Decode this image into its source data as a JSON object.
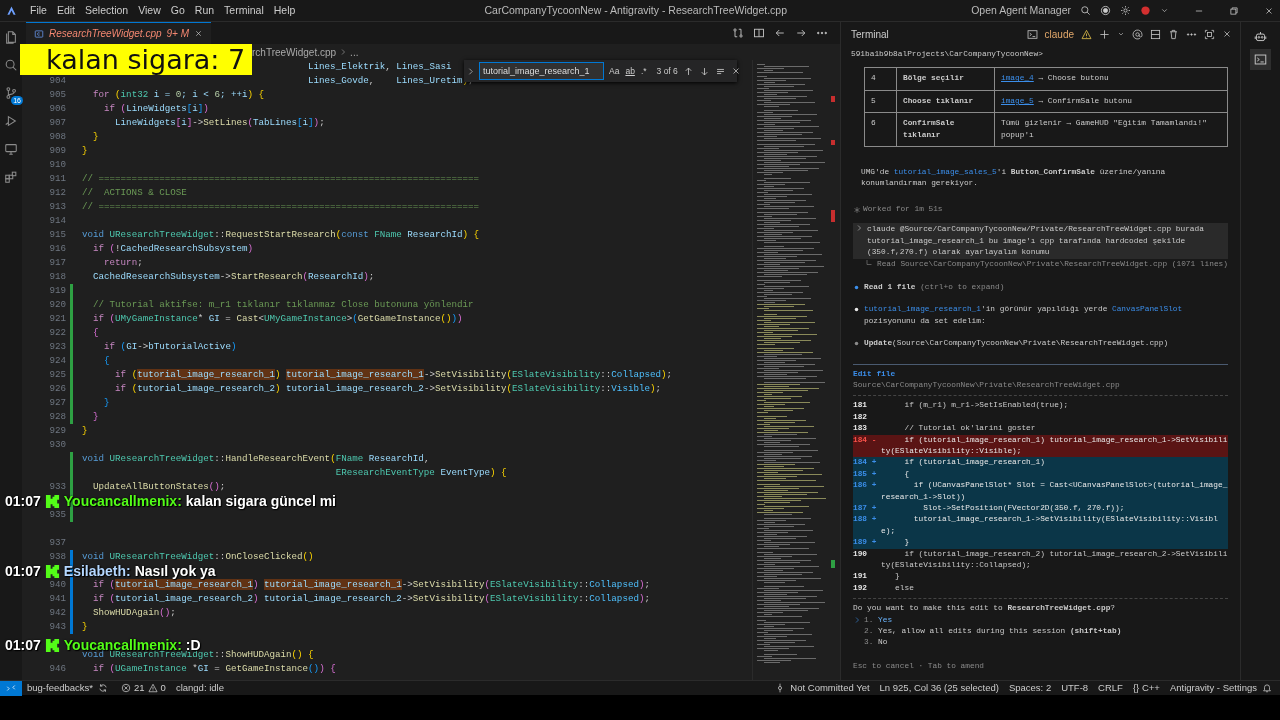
{
  "titlebar": {
    "menu": [
      "File",
      "Edit",
      "Selection",
      "View",
      "Go",
      "Run",
      "Terminal",
      "Help"
    ],
    "title": "CarCompanyTycoonNew - Antigravity - ResearchTreeWidget.cpp",
    "agent_manager": "Open Agent Manager"
  },
  "activity_badge": "16",
  "overlay_counter": "kalan sigara: 7",
  "chat": [
    {
      "time": "01:07",
      "user": "Youcancallmenix:",
      "color": "#53fc18",
      "text": "kalan sigara güncel mi"
    },
    {
      "time": "01:07",
      "user": "Esilabeth:",
      "color": "#b4d7ff",
      "text": "Nasıl yok ya"
    },
    {
      "time": "01:07",
      "user": "Youcancallmenix:",
      "color": "#53fc18",
      "text": ":D"
    }
  ],
  "editor": {
    "tab": {
      "label": "ResearchTreeWidget.cpp",
      "badge": "9+ M"
    },
    "breadcrumb": [
      "rchTreeWidget.cpp",
      "..."
    ],
    "find": {
      "value": "tutorial_image_research_1",
      "toggles": [
        "Aa",
        "ab",
        ".*"
      ],
      "result": "3 of 6"
    },
    "lines": [
      {
        "segments": [
          {
            "text": "                                         Lines_Elektrik",
            "kind": "variable"
          },
          {
            "text": ", ",
            "kind": "plain"
          },
          {
            "text": "Lines_Sasi",
            "kind": "variable"
          }
        ]
      },
      {
        "number": "904",
        "segments": [
          {
            "text": "                                         Lines_Govde",
            "kind": "variable"
          },
          {
            "text": ",    ",
            "kind": "plain"
          },
          {
            "text": "Lines_Uretim",
            "kind": "variable"
          },
          {
            "text": ")",
            "kind": "bracket1"
          },
          {
            "text": ";",
            "kind": "plain"
          }
        ]
      },
      {
        "number": "905",
        "segments": [
          {
            "text": "  for ",
            "kind": "control"
          },
          {
            "text": "(",
            "kind": "bracket1"
          },
          {
            "text": "int32",
            "kind": "type"
          },
          {
            "text": " i = ",
            "kind": "variable"
          },
          {
            "text": "0",
            "kind": "number"
          },
          {
            "text": "; i < ",
            "kind": "variable"
          },
          {
            "text": "6",
            "kind": "number"
          },
          {
            "text": "; ++i",
            "kind": "variable"
          },
          {
            "text": ")",
            "kind": "bracket1"
          },
          {
            "text": " {",
            "kind": "bracket1"
          }
        ]
      },
      {
        "number": "906",
        "segments": [
          {
            "text": "    if ",
            "kind": "control"
          },
          {
            "text": "(",
            "kind": "bracket2"
          },
          {
            "text": "LineWidgets",
            "kind": "variable"
          },
          {
            "text": "[",
            "kind": "bracket3"
          },
          {
            "text": "i",
            "kind": "variable"
          },
          {
            "text": "]",
            "kind": "bracket3"
          },
          {
            "text": ")",
            "kind": "bracket2"
          }
        ]
      },
      {
        "number": "907",
        "segments": [
          {
            "text": "      LineWidgets",
            "kind": "variable"
          },
          {
            "text": "[",
            "kind": "bracket2"
          },
          {
            "text": "i",
            "kind": "variable"
          },
          {
            "text": "]",
            "kind": "bracket2"
          },
          {
            "text": "->",
            "kind": "plain"
          },
          {
            "text": "SetLines",
            "kind": "function"
          },
          {
            "text": "(",
            "kind": "bracket2"
          },
          {
            "text": "TabLines",
            "kind": "variable"
          },
          {
            "text": "[",
            "kind": "bracket3"
          },
          {
            "text": "i",
            "kind": "variable"
          },
          {
            "text": "]",
            "kind": "bracket3"
          },
          {
            "text": ")",
            "kind": "bracket2"
          },
          {
            "text": ";",
            "kind": "plain"
          }
        ]
      },
      {
        "number": "908",
        "segments": [
          {
            "text": "  }",
            "kind": "bracket1"
          }
        ]
      },
      {
        "number": "909",
        "segments": [
          {
            "text": "}",
            "kind": "bracket1"
          }
        ]
      },
      {
        "number": "910"
      },
      {
        "number": "911",
        "segments": [
          {
            "text": "// =====================================================================",
            "kind": "comment"
          }
        ]
      },
      {
        "number": "912",
        "segments": [
          {
            "text": "//  ACTIONS & CLOSE",
            "kind": "comment"
          }
        ]
      },
      {
        "number": "913",
        "segments": [
          {
            "text": "// =====================================================================",
            "kind": "comment"
          }
        ]
      },
      {
        "number": "914"
      },
      {
        "number": "915",
        "segments": [
          {
            "text": "void ",
            "kind": "keyword"
          },
          {
            "text": "UResearchTreeWidget",
            "kind": "type"
          },
          {
            "text": "::",
            "kind": "plain"
          },
          {
            "text": "RequestStartResearch",
            "kind": "function"
          },
          {
            "text": "(",
            "kind": "bracket1"
          },
          {
            "text": "const ",
            "kind": "keyword"
          },
          {
            "text": "FName",
            "kind": "type"
          },
          {
            "text": " ResearchId",
            "kind": "variable"
          },
          {
            "text": ")",
            "kind": "bracket1"
          },
          {
            "text": " {",
            "kind": "bracket1"
          }
        ]
      },
      {
        "number": "916",
        "segments": [
          {
            "text": "  if ",
            "kind": "control"
          },
          {
            "text": "(",
            "kind": "bracket2"
          },
          {
            "text": "!",
            "kind": "plain"
          },
          {
            "text": "CachedResearchSubsystem",
            "kind": "variable"
          },
          {
            "text": ")",
            "kind": "bracket2"
          }
        ]
      },
      {
        "number": "917",
        "segments": [
          {
            "text": "    return",
            "kind": "control"
          },
          {
            "text": ";",
            "kind": "plain"
          }
        ]
      },
      {
        "number": "918",
        "segments": [
          {
            "text": "  CachedResearchSubsystem",
            "kind": "variable"
          },
          {
            "text": "->",
            "kind": "plain"
          },
          {
            "text": "StartResearch",
            "kind": "function"
          },
          {
            "text": "(",
            "kind": "bracket2"
          },
          {
            "text": "ResearchId",
            "kind": "variable"
          },
          {
            "text": ")",
            "kind": "bracket2"
          },
          {
            "text": ";",
            "kind": "plain"
          }
        ]
      },
      {
        "number": "919",
        "color": "#2ea043"
      },
      {
        "number": "920",
        "color": "#2ea043",
        "segments": [
          {
            "text": "  // Tutorial aktifse: m_r1 tıklanır tıklanmaz Close butonuna yönlendir",
            "kind": "comment"
          }
        ]
      },
      {
        "number": "921",
        "color": "#2ea043",
        "segments": [
          {
            "text": "  if ",
            "kind": "control"
          },
          {
            "text": "(",
            "kind": "bracket2"
          },
          {
            "text": "UMyGameInstance",
            "kind": "type"
          },
          {
            "text": "* ",
            "kind": "plain"
          },
          {
            "text": "GI",
            "kind": "variable"
          },
          {
            "text": " = ",
            "kind": "plain"
          },
          {
            "text": "Cast",
            "kind": "function"
          },
          {
            "text": "<",
            "kind": "plain"
          },
          {
            "text": "UMyGameInstance",
            "kind": "type"
          },
          {
            "text": ">",
            "kind": "plain"
          },
          {
            "text": "(",
            "kind": "bracket3"
          },
          {
            "text": "GetGameInstance",
            "kind": "function"
          },
          {
            "text": "()",
            "kind": "bracket1"
          },
          {
            "text": ")",
            "kind": "bracket3"
          },
          {
            "text": ")",
            "kind": "bracket2"
          }
        ]
      },
      {
        "number": "922",
        "color": "#2ea043",
        "segments": [
          {
            "text": "  {",
            "kind": "bracket2"
          }
        ]
      },
      {
        "number": "923",
        "color": "#2ea043",
        "segments": [
          {
            "text": "    if ",
            "kind": "control"
          },
          {
            "text": "(",
            "kind": "bracket3"
          },
          {
            "text": "GI",
            "kind": "variable"
          },
          {
            "text": "->",
            "kind": "plain"
          },
          {
            "text": "bTutorialActive",
            "kind": "variable"
          },
          {
            "text": ")",
            "kind": "bracket3"
          }
        ]
      },
      {
        "number": "924",
        "color": "#2ea043",
        "segments": [
          {
            "text": "    {",
            "kind": "bracket3"
          }
        ]
      },
      {
        "number": "925",
        "color": "#2ea043",
        "segments": [
          {
            "text": "      if ",
            "kind": "control"
          },
          {
            "text": "(",
            "kind": "bracket1"
          },
          {
            "text": "tutorial_image_research_1",
            "kind": "variable",
            "match": true
          },
          {
            "text": ") ",
            "kind": "bracket1"
          },
          {
            "text": "tutorial_image_research_1",
            "kind": "variable",
            "match": true
          },
          {
            "text": "->",
            "kind": "plain"
          },
          {
            "text": "SetVisibility",
            "kind": "function"
          },
          {
            "text": "(",
            "kind": "bracket1"
          },
          {
            "text": "ESlateVisibility",
            "kind": "type"
          },
          {
            "text": "::",
            "kind": "plain"
          },
          {
            "text": "Collapsed",
            "kind": "enum"
          },
          {
            "text": ")",
            "kind": "bracket1"
          },
          {
            "text": ";",
            "kind": "plain"
          }
        ]
      },
      {
        "number": "926",
        "color": "#2ea043",
        "segments": [
          {
            "text": "      if ",
            "kind": "control"
          },
          {
            "text": "(",
            "kind": "bracket1"
          },
          {
            "text": "tutorial_image_research_2",
            "kind": "variable"
          },
          {
            "text": ") ",
            "kind": "bracket1"
          },
          {
            "text": "tutorial_image_research_2",
            "kind": "variable"
          },
          {
            "text": "->",
            "kind": "plain"
          },
          {
            "text": "SetVisibility",
            "kind": "function"
          },
          {
            "text": "(",
            "kind": "bracket1"
          },
          {
            "text": "ESlateVisibility",
            "kind": "type"
          },
          {
            "text": "::",
            "kind": "plain"
          },
          {
            "text": "Visible",
            "kind": "enum"
          },
          {
            "text": ")",
            "kind": "bracket1"
          },
          {
            "text": ";",
            "kind": "plain"
          }
        ]
      },
      {
        "number": "927",
        "color": "#2ea043",
        "segments": [
          {
            "text": "    }",
            "kind": "bracket3"
          }
        ]
      },
      {
        "number": "928",
        "color": "#2ea043",
        "segments": [
          {
            "text": "  }",
            "kind": "bracket2"
          }
        ]
      },
      {
        "number": "929",
        "segments": [
          {
            "text": "}",
            "kind": "bracket1"
          }
        ]
      },
      {
        "number": "930"
      },
      {
        "color": "#2ea043",
        "segments": [
          {
            "text": "void ",
            "kind": "keyword"
          },
          {
            "text": "UResearchTreeWidget",
            "kind": "type"
          },
          {
            "text": "::",
            "kind": "plain"
          },
          {
            "text": "HandleResearchEvent",
            "kind": "function"
          },
          {
            "text": "(",
            "kind": "bracket1"
          },
          {
            "text": "FName",
            "kind": "type"
          },
          {
            "text": " ResearchId",
            "kind": "variable"
          },
          {
            "text": ",",
            "kind": "plain"
          }
        ]
      },
      {
        "color": "#2ea043",
        "segments": [
          {
            "text": "                                              EResearchEventType",
            "kind": "type"
          },
          {
            "text": " EventType",
            "kind": "variable"
          },
          {
            "text": ")",
            "kind": "bracket1"
          },
          {
            "text": " {",
            "kind": "bracket1"
          }
        ]
      },
      {
        "number": "933",
        "color": "#2ea043",
        "segments": [
          {
            "text": "  UpdateAllButtonStates",
            "kind": "function"
          },
          {
            "text": "()",
            "kind": "bracket2"
          },
          {
            "text": ";",
            "kind": "plain"
          }
        ]
      },
      {
        "color": "#2ea043"
      },
      {
        "number": "935",
        "color": "#2ea043"
      },
      {
        "number": "937"
      },
      {
        "number": "938",
        "color": "#0078d4",
        "segments": [
          {
            "text": "void ",
            "kind": "keyword"
          },
          {
            "text": "UResearchTreeWidget",
            "kind": "type"
          },
          {
            "text": "::",
            "kind": "plain"
          },
          {
            "text": "OnCloseClicked",
            "kind": "function"
          },
          {
            "text": "()",
            "kind": "bracket1"
          }
        ]
      },
      {
        "color": "#0078d4"
      },
      {
        "number": "940",
        "color": "#0078d4",
        "segments": [
          {
            "text": "  if ",
            "kind": "control"
          },
          {
            "text": "(",
            "kind": "bracket2"
          },
          {
            "text": "tutorial_image_research_1",
            "kind": "variable",
            "match": true
          },
          {
            "text": ") ",
            "kind": "bracket2"
          },
          {
            "text": "tutorial_image_research_1",
            "kind": "variable",
            "match": true
          },
          {
            "text": "->",
            "kind": "plain"
          },
          {
            "text": "SetVisibility",
            "kind": "function"
          },
          {
            "text": "(",
            "kind": "bracket2"
          },
          {
            "text": "ESlateVisibility",
            "kind": "type"
          },
          {
            "text": "::",
            "kind": "plain"
          },
          {
            "text": "Collapsed",
            "kind": "enum"
          },
          {
            "text": ")",
            "kind": "bracket2"
          },
          {
            "text": ";",
            "kind": "plain"
          }
        ]
      },
      {
        "number": "941",
        "color": "#0078d4",
        "segments": [
          {
            "text": "  if ",
            "kind": "control"
          },
          {
            "text": "(",
            "kind": "bracket2"
          },
          {
            "text": "tutorial_image_research_2",
            "kind": "variable"
          },
          {
            "text": ") ",
            "kind": "bracket2"
          },
          {
            "text": "tutorial_image_research_2",
            "kind": "variable"
          },
          {
            "text": "->",
            "kind": "plain"
          },
          {
            "text": "SetVisibility",
            "kind": "function"
          },
          {
            "text": "(",
            "kind": "bracket2"
          },
          {
            "text": "ESlateVisibility",
            "kind": "type"
          },
          {
            "text": "::",
            "kind": "plain"
          },
          {
            "text": "Collapsed",
            "kind": "enum"
          },
          {
            "text": ")",
            "kind": "bracket2"
          },
          {
            "text": ";",
            "kind": "plain"
          }
        ]
      },
      {
        "number": "942",
        "color": "#0078d4",
        "segments": [
          {
            "text": "  ShowHUDAgain",
            "kind": "function"
          },
          {
            "text": "()",
            "kind": "bracket2"
          },
          {
            "text": ";",
            "kind": "plain"
          }
        ]
      },
      {
        "number": "943",
        "color": "#0078d4",
        "segments": [
          {
            "text": "}",
            "kind": "bracket1"
          }
        ]
      },
      {
        "segments": [
          {
            "text": "void ",
            "kind": "keyword"
          },
          {
            "text": "UResearchTreeWidget",
            "kind": "type"
          },
          {
            "text": "::",
            "kind": "plain"
          },
          {
            "text": "ShowHUDAgain",
            "kind": "function"
          },
          {
            "text": "()",
            "kind": "bracket1"
          },
          {
            "text": " {",
            "kind": "bracket1"
          }
        ]
      },
      {
        "number": "946",
        "segments": [
          {
            "text": "  if ",
            "kind": "control"
          },
          {
            "text": "(",
            "kind": "bracket2"
          },
          {
            "text": "UGameInstance",
            "kind": "type"
          },
          {
            "text": " *",
            "kind": "plain"
          },
          {
            "text": "GI",
            "kind": "variable"
          },
          {
            "text": " = ",
            "kind": "plain"
          },
          {
            "text": "GetGameInstance",
            "kind": "function"
          },
          {
            "text": "()",
            "kind": "bracket3"
          },
          {
            "text": ")",
            "kind": "bracket2"
          },
          {
            "text": " {",
            "kind": "bracket2"
          }
        ]
      }
    ]
  },
  "terminal": {
    "title": "Terminal",
    "session": "claude",
    "path": "591ba1b9b8alProjects\\CarCompanyTycoonNew>",
    "table": [
      {
        "step": "4",
        "action": "Bölge seçilir",
        "link": "image_4",
        "detail": " → Choose butonu"
      },
      {
        "step": "5",
        "action": "Choose tıklanır",
        "link": "image_5",
        "detail": " → ConfirmSale butonu"
      },
      {
        "step": "6",
        "action": "ConfirmSale tıklanır",
        "detail": "Tümü gizlenir → GameHUD \"Eğitim Tamamlandı!\" popup'ı"
      }
    ],
    "note": [
      {
        "text": "UMG'de ",
        "kind": "plain"
      },
      {
        "text": "tutorial_image_sales_5",
        "kind": "code"
      },
      {
        "text": "'i ",
        "kind": "plain"
      },
      {
        "text": "Button_ConfirmSale",
        "kind": "bold"
      },
      {
        "text": " üzerine/yanına konumlandırman gerekiyor.",
        "kind": "plain"
      }
    ],
    "worked": "Worked for 1m 51s",
    "prompt": "claude @Source/CarCompanyTycoonNew/Private/ResearchTreeWidget.cpp burada tutorial_image_research_1 bu image'ı cpp tarafında hardcoded şekilde (350.f,270.f)  olarak ayarlayalım konumu",
    "tool_result": "Read Source\\CarCompanyTycoonNew\\Private\\ResearchTreeWidget.cpp (1071 lines)",
    "bullets": [
      {
        "color": "#3b8eea",
        "segments": [
          {
            "text": "Read 1 file",
            "kind": "bold"
          },
          {
            "text": " (ctrl+o to expand)",
            "kind": "dim"
          }
        ]
      },
      {
        "color": "#e8e8e8",
        "segments": [
          {
            "text": "tutorial_image_research_1",
            "kind": "code"
          },
          {
            "text": "'in görünür yapıldığı yerde ",
            "kind": "plain"
          },
          {
            "text": "CanvasPanelSlot",
            "kind": "code"
          },
          {
            "text": " pozisyonunu da set edelim:",
            "kind": "plain"
          }
        ]
      },
      {
        "color": "#8a8a8a",
        "segments": [
          {
            "text": "Update",
            "kind": "bold"
          },
          {
            "text": "(Source\\CarCompanyTycoonNew\\Private\\ResearchTreeWidget.cpp)",
            "kind": "plain"
          }
        ]
      }
    ],
    "edit": {
      "title": "Edit file",
      "path": "Source\\CarCompanyTycoonNew\\Private\\ResearchTreeWidget.cpp",
      "lines": [
        {
          "number": "181",
          "kind": "context",
          "text": "     if (m_r1) m_r1->SetIsEnabled(true);"
        },
        {
          "number": "182",
          "kind": "context"
        },
        {
          "number": "183",
          "kind": "context",
          "text": "     // Tutorial ok'larini goster"
        },
        {
          "number": "184",
          "sign": "-",
          "kind": "removed",
          "text": "     if (tutorial_image_research_1) tutorial_image_research_1->SetVisibility(ESlateVisibility::Visible);"
        },
        {
          "number": "184",
          "sign": "+",
          "kind": "added",
          "text": "     if (tutorial_image_research_1)"
        },
        {
          "number": "185",
          "sign": "+",
          "kind": "added",
          "text": "     {"
        },
        {
          "number": "186",
          "sign": "+",
          "kind": "added",
          "text": "       if (UCanvasPanelSlot* Slot = Cast<UCanvasPanelSlot>(tutorial_image_research_1->Slot))"
        },
        {
          "number": "187",
          "sign": "+",
          "kind": "added",
          "text": "         Slot->SetPosition(FVector2D(350.f, 270.f));"
        },
        {
          "number": "188",
          "sign": "+",
          "kind": "added",
          "text": "       tutorial_image_research_1->SetVisibility(ESlateVisibility::Visible);"
        },
        {
          "number": "189",
          "sign": "+",
          "kind": "added",
          "text": "     }"
        },
        {
          "number": "190",
          "kind": "context",
          "text": "     if (tutorial_image_research_2) tutorial_image_research_2->SetVisibility(ESlateVisibility::Collapsed);"
        },
        {
          "number": "191",
          "kind": "context",
          "text": "   }"
        },
        {
          "number": "192",
          "kind": "context",
          "text": "   else"
        }
      ]
    },
    "question": "Do you want to make this edit to **ResearchTreeWidget.cpp**?",
    "options": [
      {
        "number": "1.",
        "label": "Yes",
        "selected": true
      },
      {
        "number": "2.",
        "label": "Yes, allow all edits during this session **(shift+tab)**",
        "selected": false
      },
      {
        "number": "3.",
        "label": "No",
        "selected": false
      }
    ],
    "hint": "Esc to cancel · Tab to amend"
  },
  "status": {
    "branch": "bug-feedbacks*",
    "errors": "21",
    "warnings": "0",
    "language_server": "clangd: idle",
    "right": [
      "Not Committed Yet",
      "Ln 925, Col 36 (25 selected)",
      "Spaces: 2",
      "UTF-8",
      "CRLF",
      "{} C++",
      "Antigravity - Settings"
    ]
  }
}
